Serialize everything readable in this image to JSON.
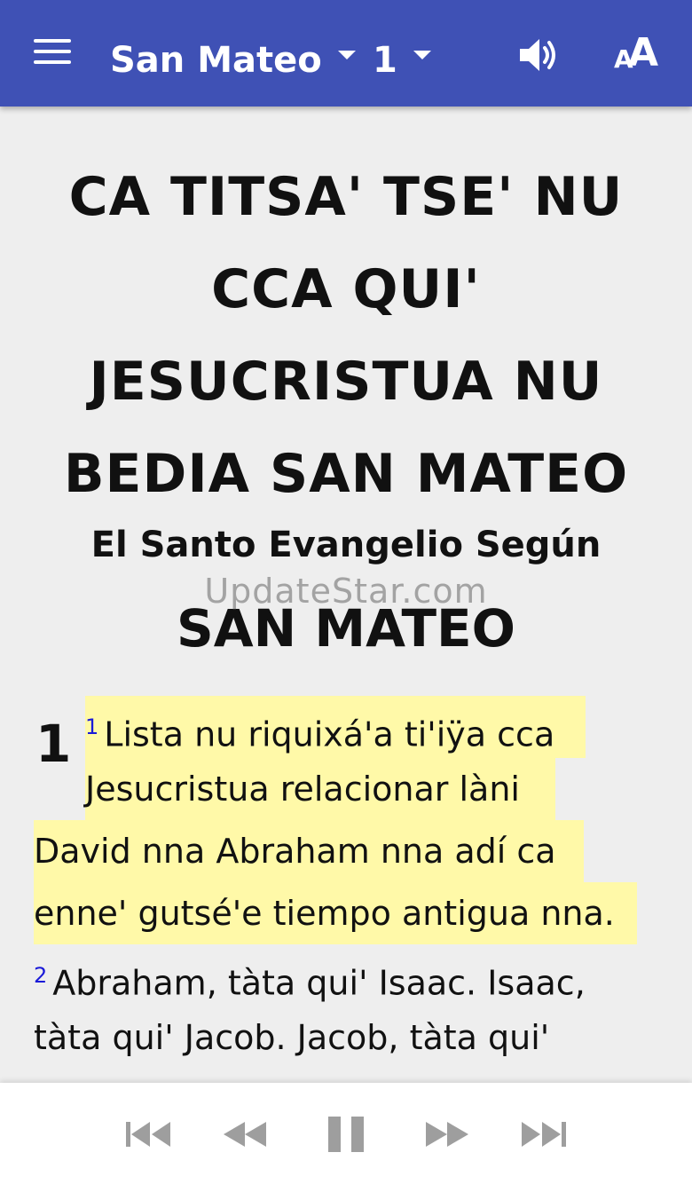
{
  "appbar": {
    "book": "San Mateo",
    "chapter": "1",
    "menu_icon": "hamburger-menu-icon",
    "audio_icon": "speaker-icon",
    "textsize_icon": "text-size-icon",
    "textsize_small": "A",
    "textsize_big": "A",
    "color": "#3f51b5"
  },
  "content": {
    "heading_lines": [
      "CA TITSA' TSE' NU",
      "CCA QUI'",
      "JESUCRISTUA NU",
      "BEDIA SAN MATEO"
    ],
    "subheading": "El Santo Evangelio Según",
    "book_name": "SAN MATEO",
    "watermark": "UpdateStar.com",
    "chapter_number": "1",
    "verses": [
      {
        "number": "1",
        "highlighted": true,
        "lines": [
          "Lista nu riquixá'a ti'iÿa cca",
          "Jesucristua relacionar làni",
          "David nna Abraham nna adí ca",
          "enne' gutsé'e tiempo antigua nna."
        ]
      },
      {
        "number": "2",
        "highlighted": false,
        "lines": [
          "Abraham, tàta qui' Isaac. Isaac,",
          "tàta qui' Jacob. Jacob, tàta qui'"
        ]
      }
    ],
    "highlight_color": "#fff9a8"
  },
  "player": {
    "icons": [
      "skip-previous-icon",
      "rewind-icon",
      "pause-icon",
      "fast-forward-icon",
      "skip-next-icon"
    ],
    "icon_color": "#9e9e9e"
  }
}
